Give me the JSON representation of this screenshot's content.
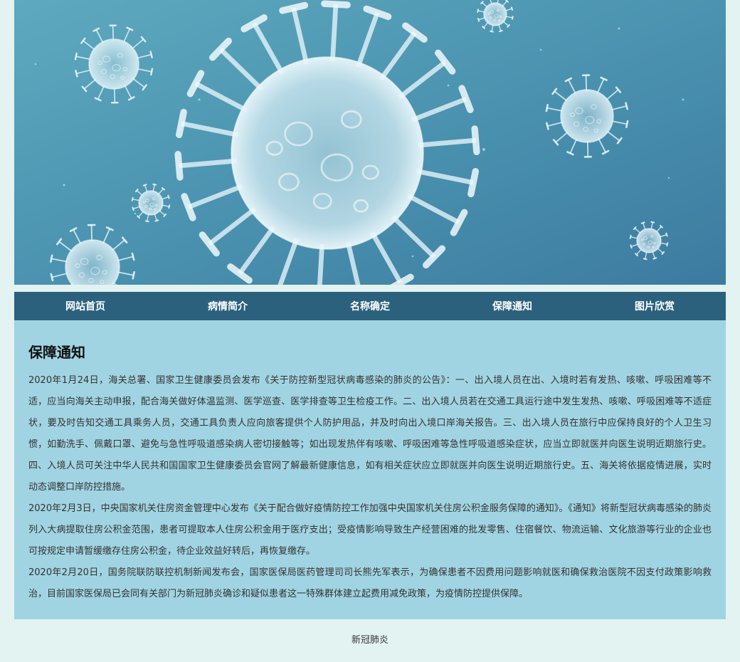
{
  "banner": {
    "alt": "virus"
  },
  "nav": {
    "items": [
      "网站首页",
      "病情简介",
      "名称确定",
      "保障通知",
      "图片欣赏"
    ]
  },
  "main": {
    "title": "保障通知",
    "paragraphs": [
      "2020年1月24日，海关总署、国家卫生健康委员会发布《关于防控新型冠状病毒感染的肺炎的公告》：一、出入境人员在出、入境时若有发热、咳嗽、呼吸困难等不适，应当向海关主动申报，配合海关做好体温监测、医学巡查、医学排查等卫生检疫工作。二、出入境人员若在交通工具运行途中发生发热、咳嗽、呼吸困难等不适症状，要及时告知交通工具乘务人员，交通工具负责人应向旅客提供个人防护用品，并及时向出入境口岸海关报告。三、出入境人员在旅行中应保持良好的个人卫生习惯，如勤洗手、佩戴口罩、避免与急性呼吸道感染病人密切接触等；如出现发热伴有咳嗽、呼吸困难等急性呼吸道感染症状，应当立即就医并向医生说明近期旅行史。四、入境人员可关注中华人民共和国国家卫生健康委员会官网了解最新健康信息，如有相关症状应立即就医并向医生说明近期旅行史。五、海关将依据疫情进展，实时动态调整口岸防控措施。",
      "2020年2月3日，中央国家机关住房资金管理中心发布《关于配合做好疫情防控工作加强中央国家机关住房公积金服务保障的通知》。《通知》将新型冠状病毒感染的肺炎列入大病提取住房公积金范围，患者可提取本人住房公积金用于医疗支出；受疫情影响导致生产经营困难的批发零售、住宿餐饮、物流运输、文化旅游等行业的企业也可按规定申请暂缓缴存住房公积金，待企业效益好转后，再恢复缴存。",
      "2020年2月20日，国务院联防联控机制新闻发布会，国家医保局医药管理司司长熊先军表示，为确保患者不因费用问题影响就医和确保救治医院不因支付政策影响救治，目前国家医保局已会同有关部门为新冠肺炎确诊和疑似患者这一特殊群体建立起费用减免政策，为疫情防控提供保障。"
    ]
  },
  "footer": {
    "text": "新冠肺炎"
  },
  "colors": {
    "page_bg": "#e3f3f1",
    "nav_bg": "#2b617d",
    "content_bg": "#a1d4e2",
    "banner_top": "#6ab1c6",
    "banner_bottom": "#3d7ea3"
  }
}
